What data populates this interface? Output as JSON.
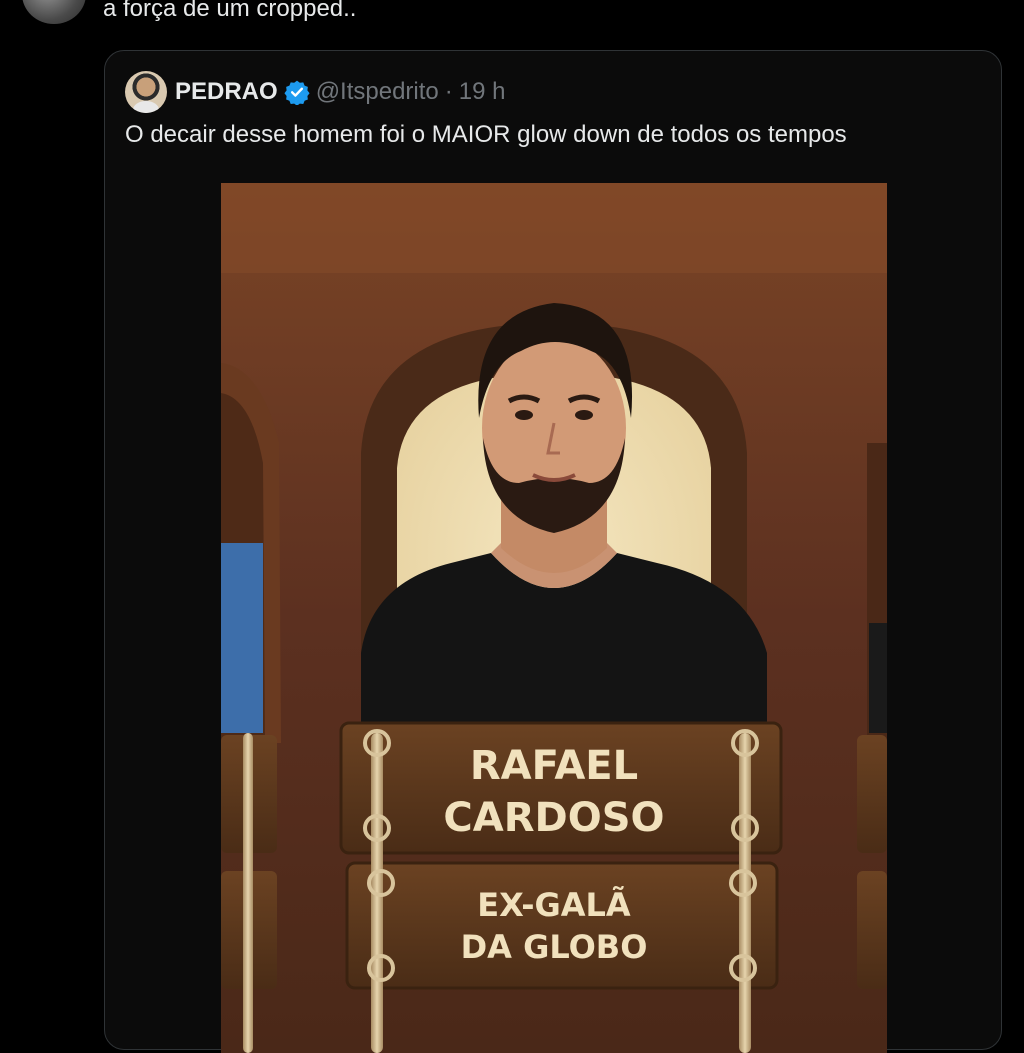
{
  "reply": {
    "text": "a força de um cropped.."
  },
  "quoted_tweet": {
    "display_name": "PEDRAO",
    "handle": "@Itspedrito",
    "separator": "·",
    "time": "19 h",
    "text": "O decair desse homem foi o MAIOR glow down de todos os tempos",
    "media": {
      "sign_name_line1": "RAFAEL",
      "sign_name_line2": "CARDOSO",
      "sign_title_line1": "EX-GALÃ",
      "sign_title_line2": "DA GLOBO"
    }
  },
  "colors": {
    "background": "#000000",
    "text": "#e7e9ea",
    "secondary_text": "#71767b",
    "verified_blue": "#1d9bf0",
    "border": "#2f3336"
  },
  "icons": {
    "verified": "verified-badge-icon"
  }
}
